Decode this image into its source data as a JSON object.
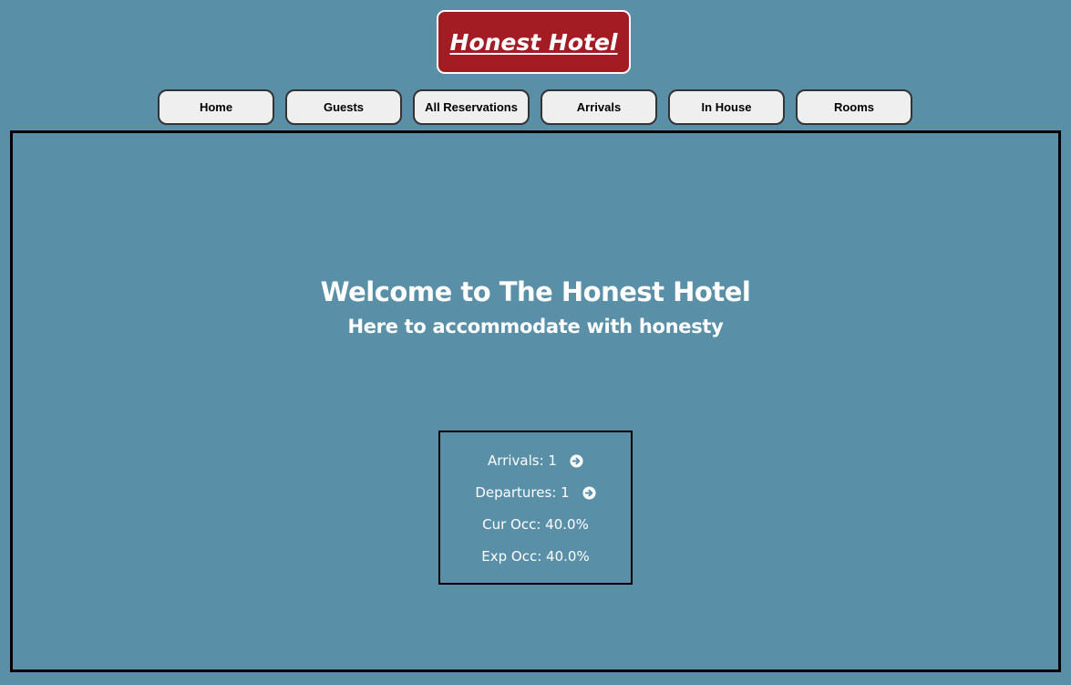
{
  "header": {
    "logo_text": "Honest Hotel"
  },
  "nav": {
    "items": [
      {
        "label": "Home"
      },
      {
        "label": "Guests"
      },
      {
        "label": "All Reservations"
      },
      {
        "label": "Arrivals"
      },
      {
        "label": "In House"
      },
      {
        "label": "Rooms"
      }
    ]
  },
  "main": {
    "title": "Welcome to The Honest Hotel",
    "subtitle": "Here to accommodate with honesty"
  },
  "stats": {
    "arrivals": "Arrivals: 1",
    "departures": "Departures: 1",
    "cur_occ": "Cur Occ: 40.0%",
    "exp_occ": "Exp Occ: 40.0%",
    "arrow_icon": "circle-arrow-right-icon"
  },
  "colors": {
    "background": "#5a8fa8",
    "logo_background": "#a31c23",
    "nav_button_background": "#efefef",
    "text_light": "#ffffff"
  }
}
